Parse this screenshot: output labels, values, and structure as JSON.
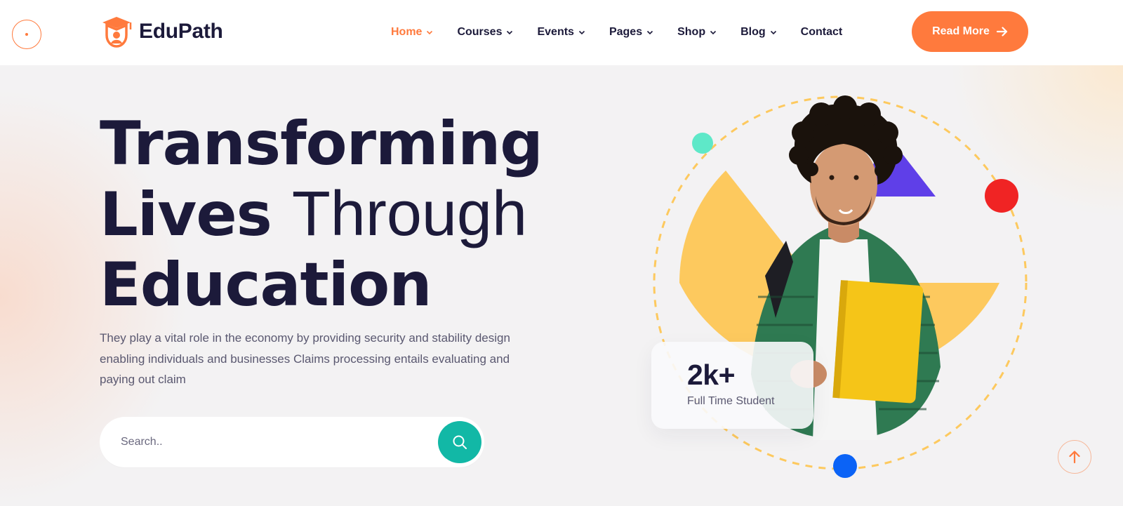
{
  "brand": {
    "name": "EduPath",
    "accent": "#ff7a3d",
    "dark": "#1c1a3a"
  },
  "nav": {
    "items": [
      {
        "label": "Home",
        "active": true,
        "has_dropdown": true
      },
      {
        "label": "Courses",
        "active": false,
        "has_dropdown": true
      },
      {
        "label": "Events",
        "active": false,
        "has_dropdown": true
      },
      {
        "label": "Pages",
        "active": false,
        "has_dropdown": true
      },
      {
        "label": "Shop",
        "active": false,
        "has_dropdown": true
      },
      {
        "label": "Blog",
        "active": false,
        "has_dropdown": true
      },
      {
        "label": "Contact",
        "active": false,
        "has_dropdown": false
      }
    ],
    "cta_label": "Read More"
  },
  "hero": {
    "title_line1": "Transforming",
    "title_line2_bold": "Lives",
    "title_line2_light": "Through",
    "title_line3": "Education",
    "description": "They play a vital role in the economy by providing security and stability design enabling individuals and businesses Claims processing entails evaluating and paying out claim",
    "search": {
      "placeholder": "Search..",
      "value": ""
    }
  },
  "stat": {
    "value": "2k+",
    "label": "Full Time Student"
  },
  "icons": {
    "logo": "graduation-cap-logo-icon",
    "cta": "arrow-right-icon",
    "search": "search-icon",
    "scroll_top": "arrow-up-icon",
    "dropdown": "chevron-down-icon"
  },
  "colors": {
    "search_button": "#12b8a6",
    "shape_yellow": "#fdc95e",
    "shape_purple": "#5f3fe8",
    "dot_red": "#f02424",
    "dot_blue": "#0b63f6",
    "dot_teal": "#5ee8c8"
  }
}
